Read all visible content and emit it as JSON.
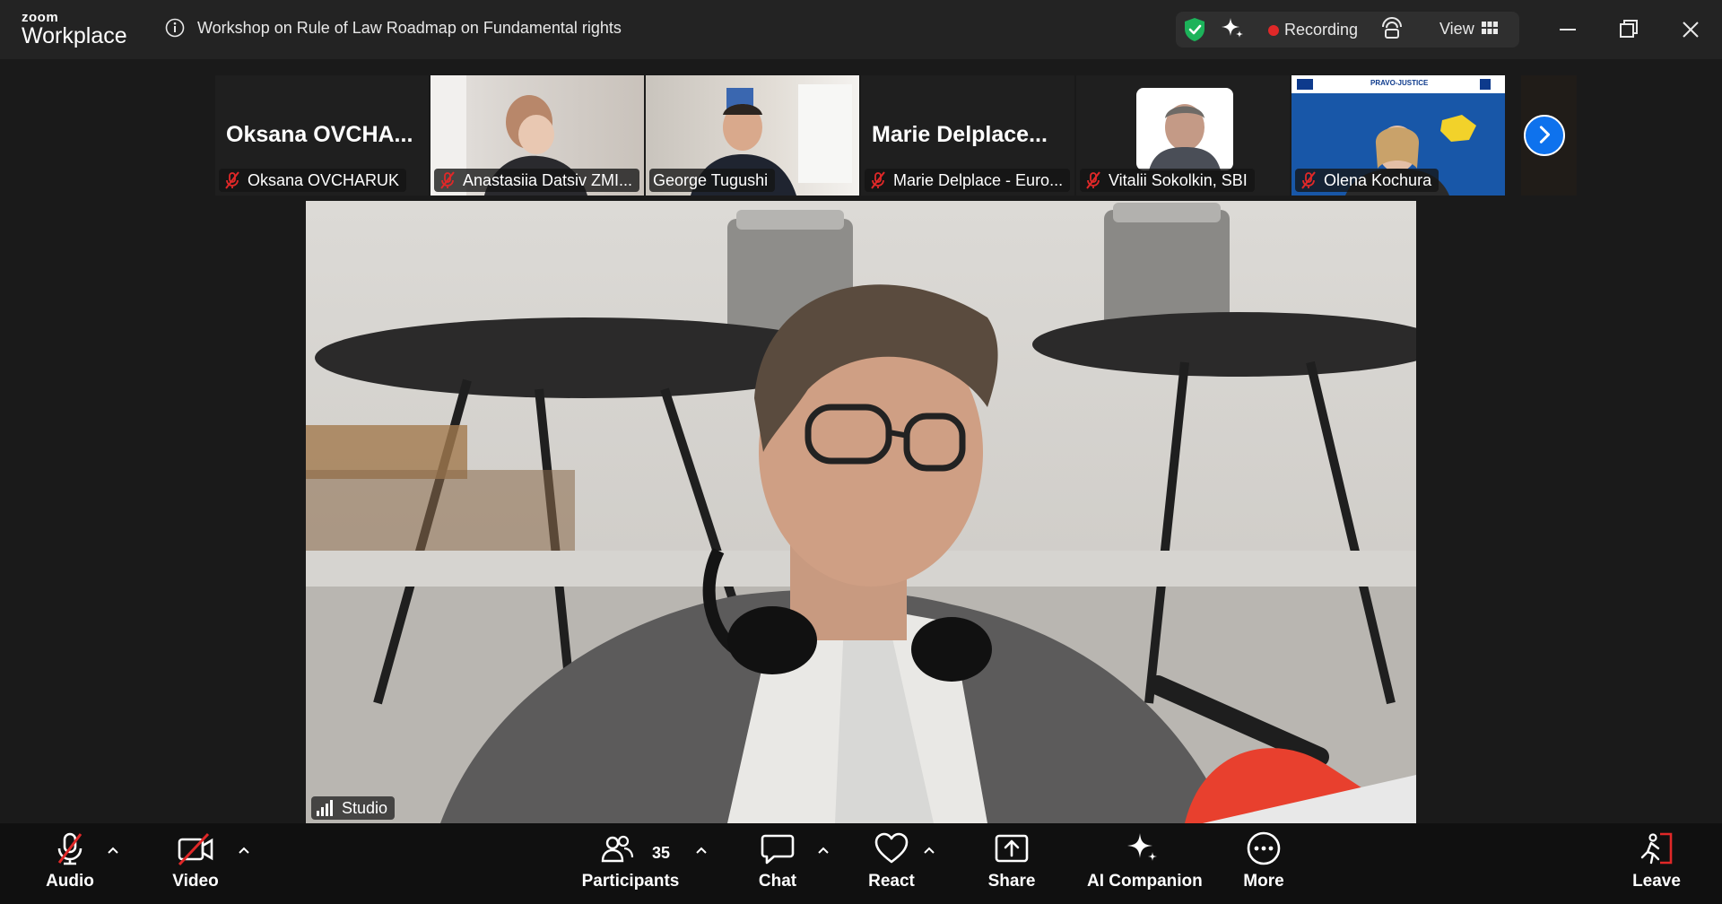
{
  "app": {
    "brand_small": "zoom",
    "brand_big": "Workplace"
  },
  "meeting": {
    "title": "Workshop on Rule of Law Roadmap on Fundamental rights"
  },
  "status": {
    "recording_label": "Recording",
    "view_label": "View"
  },
  "thumbnails": [
    {
      "big_name": "Oksana  OVCHA...",
      "label": "Oksana OVCHARUK"
    },
    {
      "label": "Anastasiia Datsiv ZMI..."
    },
    {
      "label": "George Tugushi"
    },
    {
      "big_name": "Marie  Delplace...",
      "label": "Marie Delplace - Euro..."
    },
    {
      "label": "Vitalii Sokolkin, SBI"
    },
    {
      "label": "Olena Kochura",
      "banner_text": "PRAVO-JUSTICE"
    }
  ],
  "main_video": {
    "speaker_label": "Studio"
  },
  "toolbar": {
    "audio": "Audio",
    "video": "Video",
    "participants": "Participants",
    "participant_count": "35",
    "chat": "Chat",
    "react": "React",
    "share": "Share",
    "ai_companion": "AI Companion",
    "more": "More",
    "leave": "Leave"
  },
  "colors": {
    "accent": "#0e72ed",
    "recording": "#e02828",
    "muted": "#e02828",
    "shield": "#1cb35a"
  }
}
